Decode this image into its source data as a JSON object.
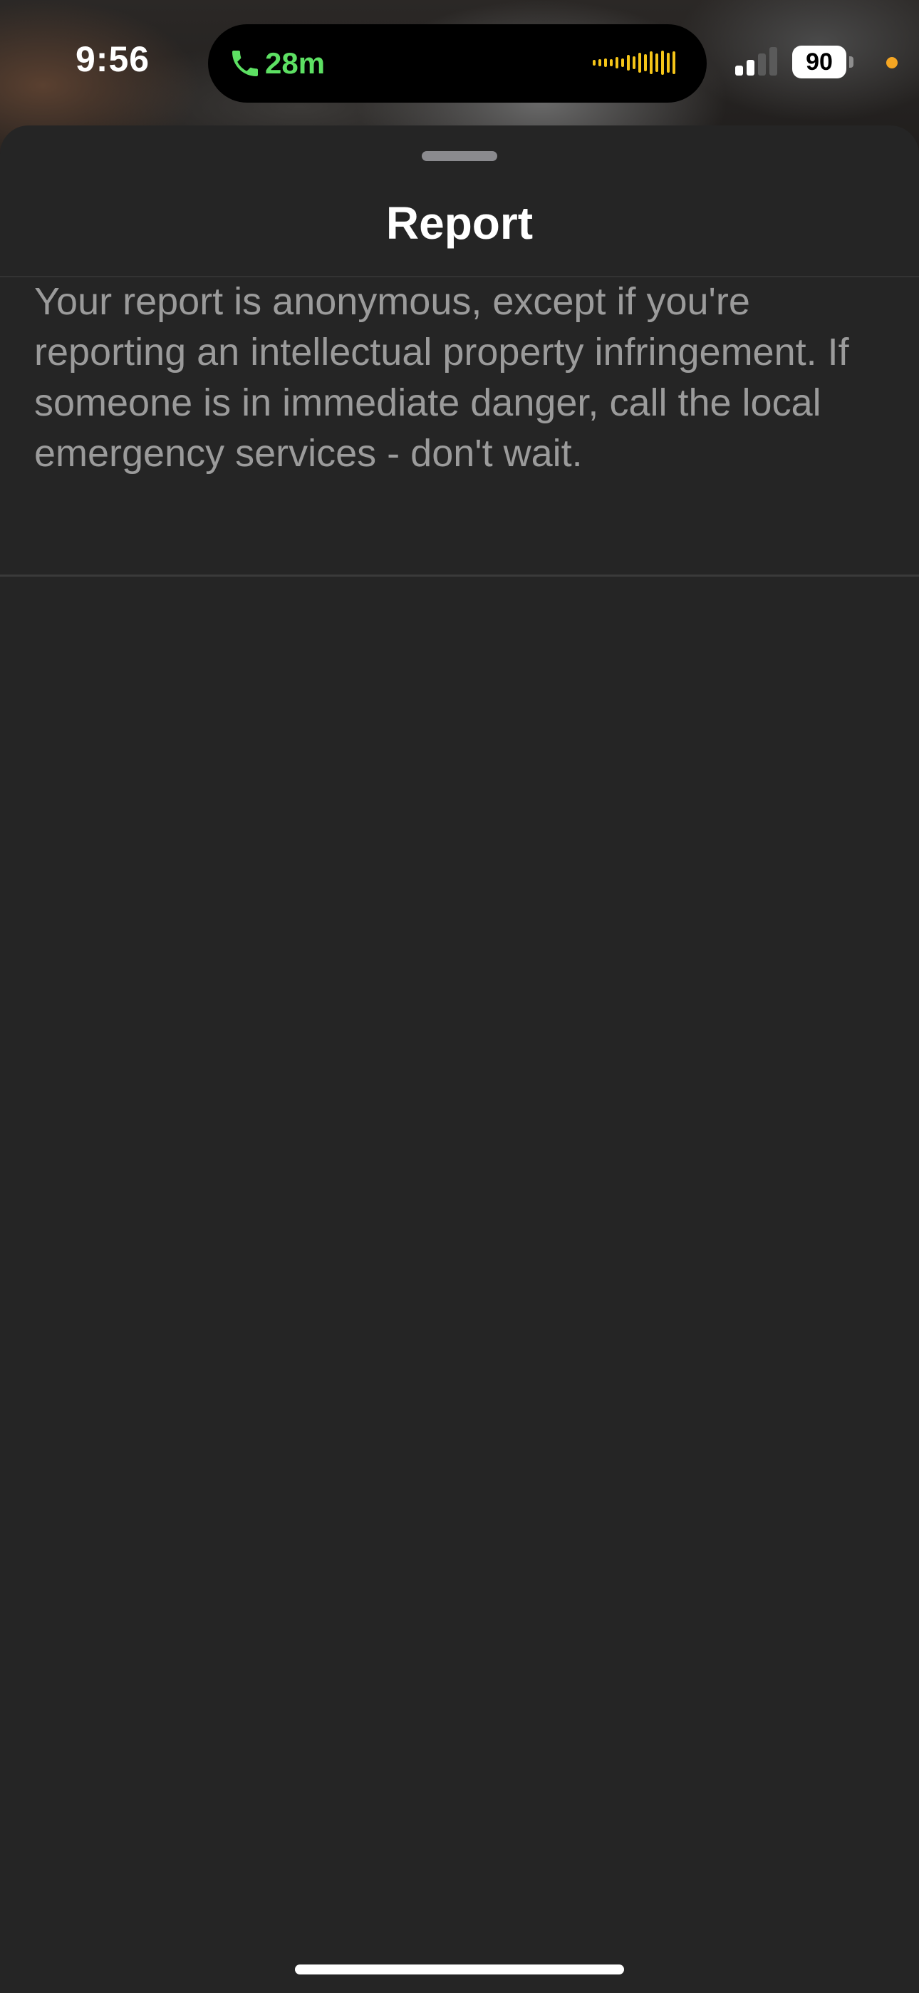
{
  "status_bar": {
    "time": "9:56",
    "call_duration": "28m",
    "battery_level": "90",
    "icons": [
      "phone-call-icon",
      "audio-waveform-icon",
      "cellular-signal-icon",
      "battery-icon",
      "privacy-indicator-dot"
    ],
    "colors": {
      "call": "#5de063",
      "waveform": "#f5c518",
      "privacy_dot": "#f5a623"
    }
  },
  "sheet": {
    "title": "Report",
    "notice": "Your report is anonymous, except if you're reporting an intellectual property infringement. If someone is in immediate danger, call the local emergency services - don't wait."
  },
  "colors": {
    "sheet_background": "#252525",
    "title_text": "#ffffff",
    "notice_text": "#9b9b9b"
  }
}
